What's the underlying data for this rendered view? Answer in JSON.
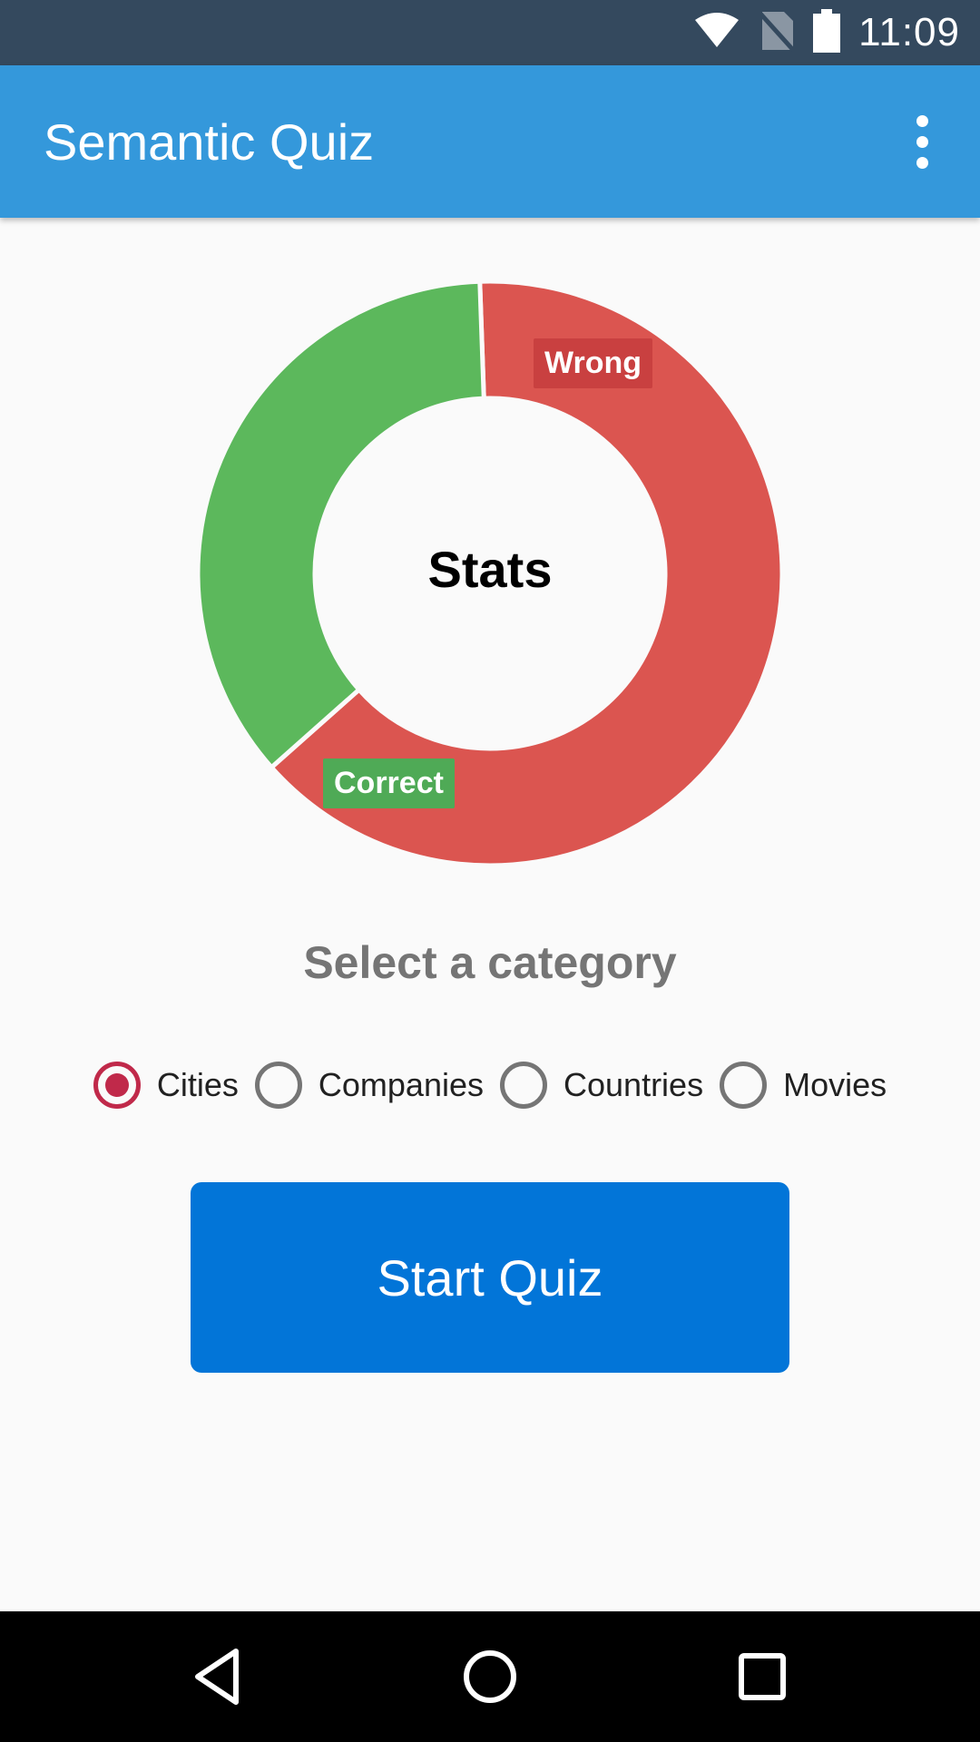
{
  "status_bar": {
    "time": "11:09"
  },
  "app_bar": {
    "title": "Semantic Quiz"
  },
  "chart_data": {
    "type": "pie",
    "title": "Stats",
    "slices": [
      {
        "label": "Wrong",
        "value": 64,
        "color": "#db5550"
      },
      {
        "label": "Correct",
        "value": 36,
        "color": "#5cb85c"
      }
    ]
  },
  "category": {
    "heading": "Select a category",
    "options": [
      "Cities",
      "Companies",
      "Countries",
      "Movies"
    ],
    "selected": "Cities"
  },
  "start_button": {
    "label": "Start Quiz"
  },
  "colors": {
    "status_bar": "#34495e",
    "app_bar": "#3498db",
    "accent_radio": "#c0294a",
    "button": "#0275d8"
  }
}
